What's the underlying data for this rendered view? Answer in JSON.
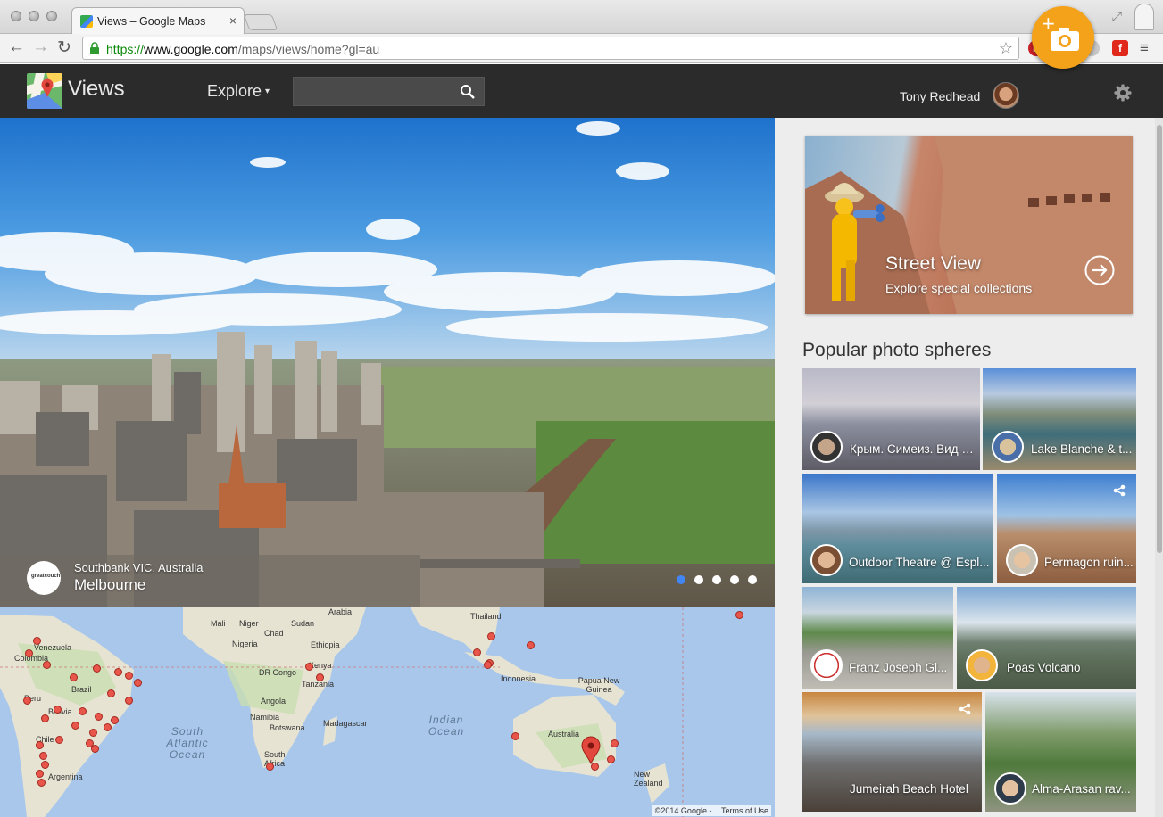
{
  "browser": {
    "tab_title": "Views – Google Maps",
    "tab_close": "×",
    "url_scheme": "https://",
    "url_host": "www.google.com",
    "url_path": "/maps/views/home?gl=au",
    "back": "←",
    "forward": "→",
    "reload": "↻",
    "star": "☆",
    "menu": "≡",
    "extensions": [
      "pinterest-icon",
      "asterisk-extension-icon",
      "ghost-extension-icon",
      "flipboard-icon"
    ]
  },
  "header": {
    "brand": "Views",
    "explore_label": "Explore",
    "explore_caret": "▾",
    "search_placeholder": "",
    "username": "Tony Redhead",
    "add_photo_plus": "+"
  },
  "hero": {
    "subtitle": "Southbank VIC, Australia",
    "title": "Melbourne",
    "logo_text": "greatcouch",
    "slides": 5,
    "active_slide": 0
  },
  "map": {
    "labels": [
      {
        "t": "Venezuela"
      },
      {
        "t": "Colombia"
      },
      {
        "t": "Brazil"
      },
      {
        "t": "Bolivia"
      },
      {
        "t": "Peru"
      },
      {
        "t": "Chile"
      },
      {
        "t": "Argentina"
      },
      {
        "t": "Mali"
      },
      {
        "t": "Niger"
      },
      {
        "t": "Sudan"
      },
      {
        "t": "Chad"
      },
      {
        "t": "Nigeria"
      },
      {
        "t": "Ethiopia"
      },
      {
        "t": "DR Congo"
      },
      {
        "t": "Kenya"
      },
      {
        "t": "Tanzania"
      },
      {
        "t": "Angola"
      },
      {
        "t": "Namibia"
      },
      {
        "t": "Botswana"
      },
      {
        "t": "Madagascar"
      },
      {
        "t": "South Africa"
      },
      {
        "t": "Arabia"
      },
      {
        "t": "Thailand"
      },
      {
        "t": "Indonesia"
      },
      {
        "t": "Papua New Guinea"
      },
      {
        "t": "Australia"
      },
      {
        "t": "New Zealand"
      }
    ],
    "oceans": [
      "South Atlantic Ocean",
      "Indian Ocean"
    ],
    "copyright": "©2014 Google -",
    "terms": "Terms of Use"
  },
  "panel": {
    "street_view_title": "Street View",
    "street_view_subtitle": "Explore special collections",
    "section_title": "Popular photo spheres",
    "spheres": [
      {
        "caption": "Крым. Симеиз. Вид с..."
      },
      {
        "caption": "Lake Blanche & t..."
      },
      {
        "caption": "Outdoor Theatre @ Espl..."
      },
      {
        "caption": "Permagon ruin..."
      },
      {
        "caption": "Franz Joseph Gl..."
      },
      {
        "caption": "Poas Volcano"
      },
      {
        "caption": "Jumeirah Beach Hotel"
      },
      {
        "caption": "Alma-Arasan rav..."
      }
    ]
  },
  "colors": {
    "header_bg": "#2b2b2b",
    "accent_orange": "#f5a21b",
    "marker_red": "#e8554a",
    "map_water": "#a8c7ea",
    "map_land": "#e7e4d8",
    "dot_active": "#4285f4"
  }
}
